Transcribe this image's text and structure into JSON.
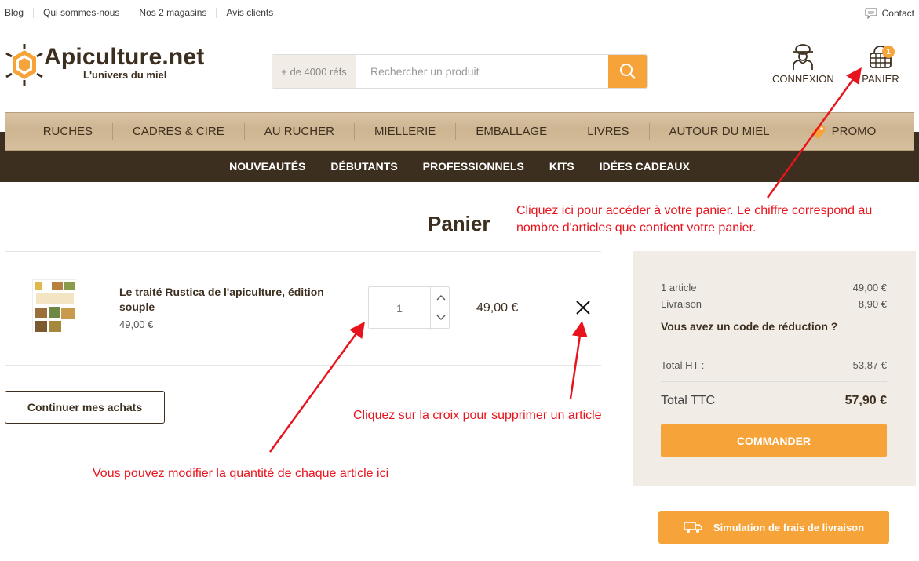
{
  "topbar": {
    "links": [
      "Blog",
      "Qui sommes-nous",
      "Nos 2 magasins",
      "Avis clients"
    ],
    "contact": "Contact"
  },
  "brand": {
    "name": "Apiculture.net",
    "tagline": "L'univers du miel"
  },
  "search": {
    "refs": "+ de 4000 réfs",
    "placeholder": "Rechercher un produit"
  },
  "account": {
    "label": "CONNEXION"
  },
  "cart": {
    "label": "PANIER",
    "count": "1"
  },
  "nav": {
    "main": [
      "RUCHES",
      "CADRES & CIRE",
      "AU RUCHER",
      "MIELLERIE",
      "EMBALLAGE",
      "LIVRES",
      "AUTOUR DU MIEL",
      "PROMO"
    ],
    "sub": [
      "NOUVEAUTÉS",
      "DÉBUTANTS",
      "PROFESSIONNELS",
      "KITS",
      "IDÉES CADEAUX"
    ]
  },
  "page": {
    "title": "Panier"
  },
  "item": {
    "name": "Le traité Rustica de l'apiculture, édition souple",
    "unit_price": "49,00 €",
    "quantity": "1",
    "line_total": "49,00 €"
  },
  "continue_label": "Continuer mes achats",
  "summary": {
    "articles_label": "1 article",
    "articles_value": "49,00 €",
    "shipping_label": "Livraison",
    "shipping_value": "8,90 €",
    "discount_label": "Vous avez un code de réduction ?",
    "ht_label": "Total HT :",
    "ht_value": "53,87 €",
    "ttc_label": "Total TTC",
    "ttc_value": "57,90 €",
    "order_button": "COMMANDER"
  },
  "shipping_sim": "Simulation de frais de livraison",
  "annotations": {
    "cart": "Cliquez ici pour accéder à votre panier. Le chiffre correspond au nombre d'articles que contient votre panier.",
    "remove": "Cliquez sur la croix pour supprimer un article",
    "quantity": "Vous pouvez modifier la quantité de chaque article ici"
  },
  "colors": {
    "accent": "#f6a33a",
    "brown": "#3d2f1f",
    "annotation": "#e8141d"
  }
}
